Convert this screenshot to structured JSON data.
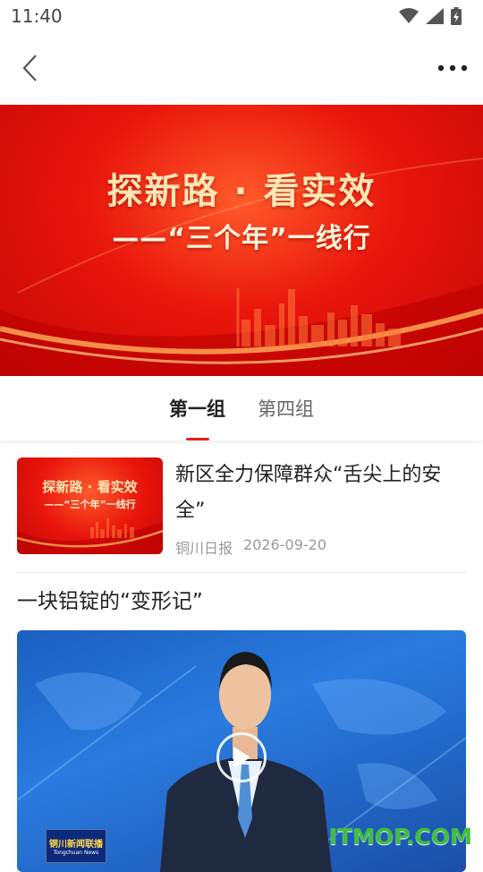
{
  "status": {
    "time": "11:40"
  },
  "banner": {
    "title": "探新路 · 看实效",
    "subtitle": "——“三个年”一线行"
  },
  "tabs": [
    {
      "label": "第一组",
      "active": true
    },
    {
      "label": "第四组",
      "active": false
    }
  ],
  "news": [
    {
      "thumb_title": "探新路 · 看实效",
      "thumb_subtitle": "——“三个年”一线行",
      "title": "新区全力保障群众“舌尖上的安全”",
      "source": "铜川日报",
      "date": "2026-09-20"
    }
  ],
  "video": {
    "title": "一块铝锭的“变形记”",
    "channel_name": "铜川新闻联播",
    "channel_en": "Tongchuan News"
  },
  "watermark": "ITMOP.COM",
  "colors": {
    "accent": "#e02020",
    "banner_red": "#e9160c"
  }
}
